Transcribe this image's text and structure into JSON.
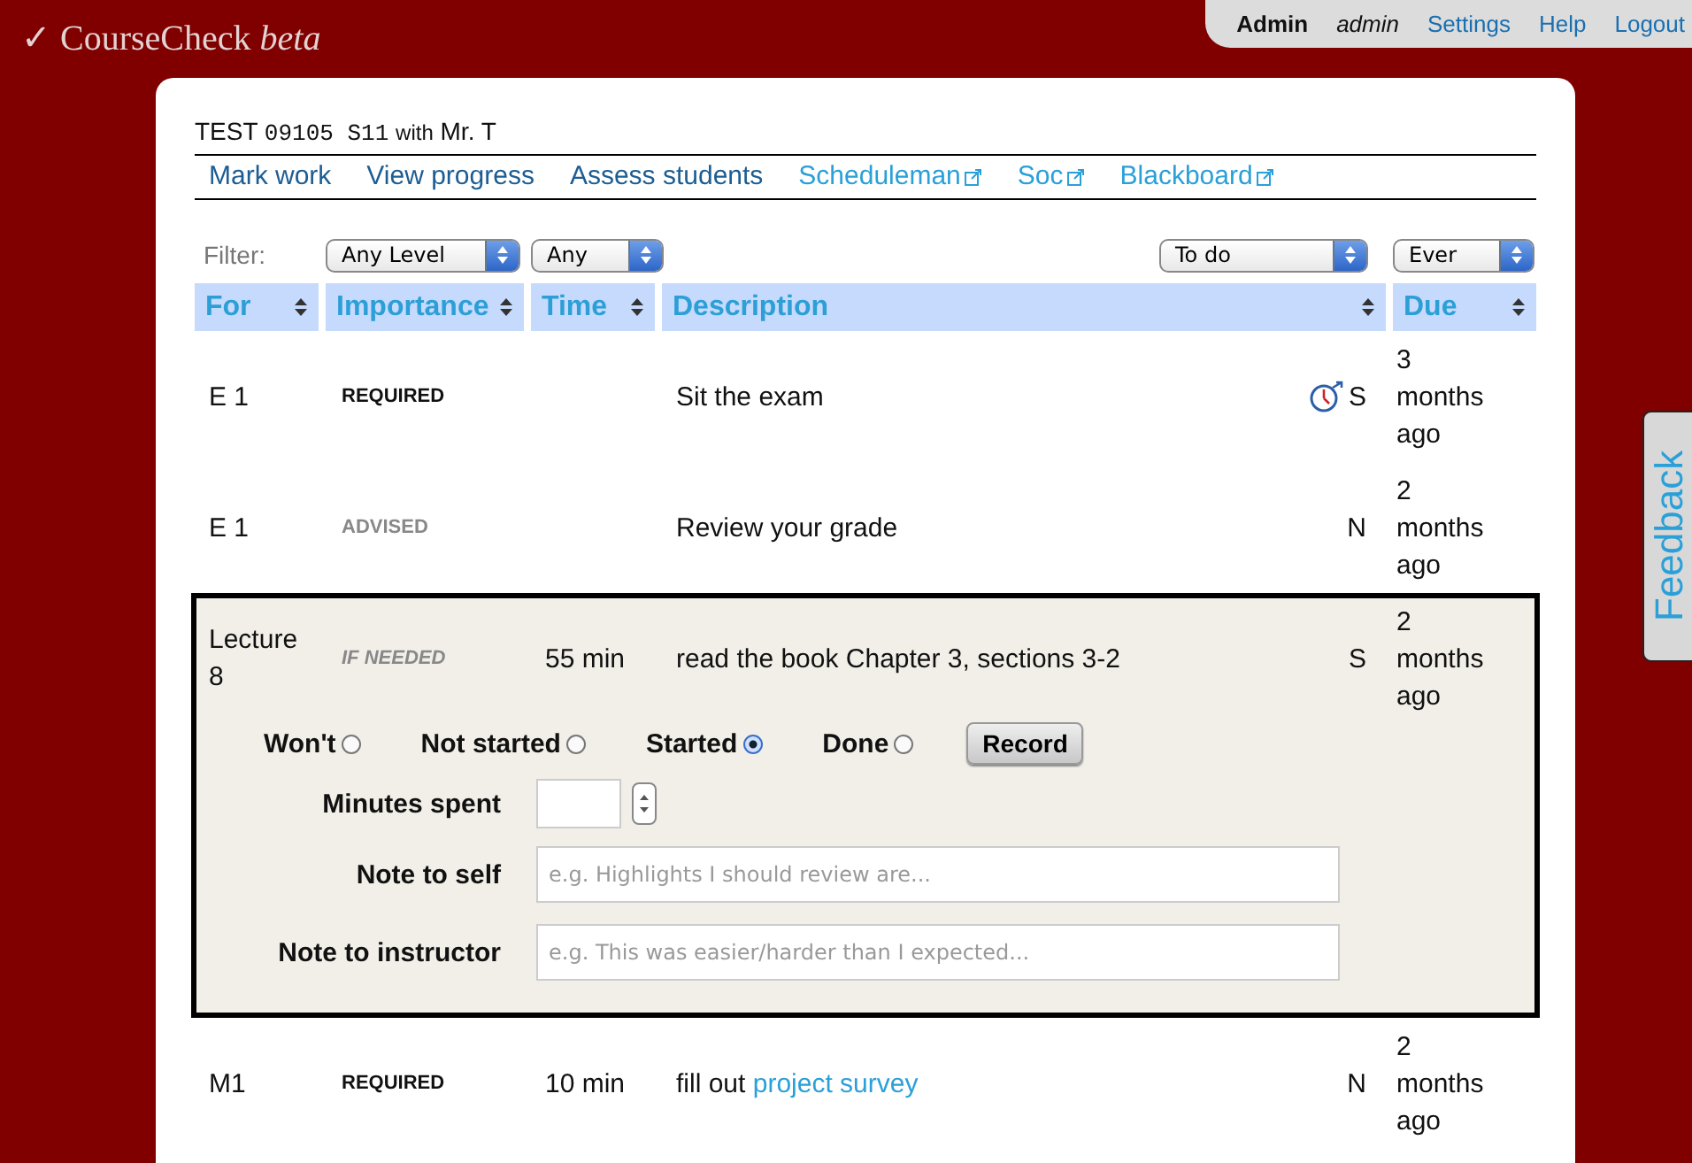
{
  "app": {
    "check": "✓",
    "name": "CourseCheck",
    "badge": "beta"
  },
  "user_menu": {
    "role": "Admin",
    "username": "admin",
    "links": [
      "Settings",
      "Help",
      "Logout"
    ]
  },
  "course": {
    "code": "TEST",
    "number": "09105",
    "term": "S11",
    "connector": "with",
    "instructor": "Mr. T"
  },
  "nav": [
    {
      "label": "Mark work",
      "external": false
    },
    {
      "label": "View progress",
      "external": false
    },
    {
      "label": "Assess students",
      "external": false
    },
    {
      "label": "Scheduleman",
      "external": true
    },
    {
      "label": "Soc",
      "external": true
    },
    {
      "label": "Blackboard",
      "external": true
    }
  ],
  "filters": {
    "label": "Filter:",
    "level": "Any Level",
    "time": "Any",
    "status": "To do",
    "due": "Ever"
  },
  "columns": [
    {
      "label": "For"
    },
    {
      "label": "Importance"
    },
    {
      "label": "Time"
    },
    {
      "label": "Description"
    },
    {
      "label": "Due"
    }
  ],
  "rows": [
    {
      "for": "E 1",
      "importance": "REQUIRED",
      "kind": "required",
      "description": "Sit the exam",
      "timed": true,
      "flag": "S",
      "due": "3 months ago",
      "expanded": false
    },
    {
      "for": "E 1",
      "importance": "ADVISED",
      "kind": "advised",
      "description": "Review your grade",
      "timed": false,
      "flag": "N",
      "due": "2 months ago",
      "expanded": false
    },
    {
      "for": "Lecture 8",
      "importance": "IF NEEDED",
      "kind": "if_needed",
      "time": "55 min",
      "description": "read the book Chapter 3, sections 3-2",
      "timed": false,
      "flag": "S",
      "due": "2 months ago",
      "expanded": true,
      "record": {
        "options": [
          {
            "label": "Won't",
            "selected": false
          },
          {
            "label": "Not started",
            "selected": false
          },
          {
            "label": "Started",
            "selected": true
          },
          {
            "label": "Done",
            "selected": false
          }
        ],
        "button": "Record",
        "minutes_label": "Minutes spent",
        "notes": [
          {
            "label": "Note to self",
            "placeholder": "e.g. Highlights I should review are..."
          },
          {
            "label": "Note to instructor",
            "placeholder": "e.g. This was easier/harder than I expected..."
          }
        ]
      }
    },
    {
      "for": "M1",
      "importance": "REQUIRED",
      "kind": "required",
      "time": "10 min",
      "description": "fill out",
      "link": "project survey",
      "timed": false,
      "flag": "N",
      "due": "2 months ago",
      "expanded": false
    }
  ],
  "feedback": "Feedback"
}
